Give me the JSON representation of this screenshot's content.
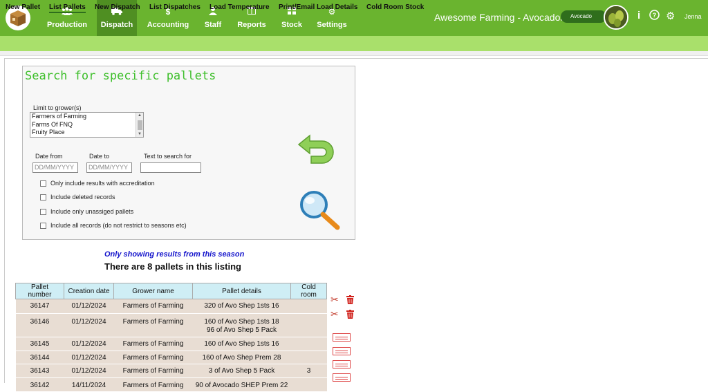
{
  "app": {
    "title": "Awesome Farming - Avocados",
    "crop_pill": "Avocado",
    "user": "Jenna"
  },
  "nav": [
    {
      "label": "Production",
      "icon": "users-icon"
    },
    {
      "label": "Dispatch",
      "icon": "truck-icon"
    },
    {
      "label": "Accounting",
      "icon": "dollar-icon"
    },
    {
      "label": "Staff",
      "icon": "person-icon"
    },
    {
      "label": "Reports",
      "icon": "columns-icon"
    },
    {
      "label": "Stock",
      "icon": "grid-icon"
    },
    {
      "label": "Settings",
      "icon": "gear-icon"
    }
  ],
  "subnav": [
    "New Pallet",
    "List Pallets",
    "New Dispatch",
    "List Dispatches",
    "Load Temperature",
    "Print/Email Load Details",
    "Cold Room Stock"
  ],
  "search": {
    "title": "Search for specific pallets",
    "grower_label": "Limit to grower(s)",
    "growers": [
      "Farmers of Farming",
      "Farms Of FNQ",
      "Fruity Place"
    ],
    "date_from_label": "Date from",
    "date_to_label": "Date to",
    "text_label": "Text to search for",
    "date_placeholder": "DD/MM/YYYY",
    "checkboxes": [
      "Only include results with accreditation",
      "Include deleted records",
      "Include only unassiged pallets",
      "Include all records (do not restrict to seasons etc)"
    ]
  },
  "results": {
    "season_note": "Only showing results from this season",
    "count_text": "There are 8 pallets in this listing",
    "headers": [
      "Pallet number",
      "Creation date",
      "Grower name",
      "Pallet details",
      "Cold room"
    ],
    "rows": [
      {
        "pallet": "36147",
        "date": "01/12/2024",
        "grower": "Farmers of Farming",
        "details": [
          "320 of Avo Shep 1sts 16"
        ],
        "cold": ""
      },
      {
        "pallet": "36146",
        "date": "01/12/2024",
        "grower": "Farmers of Farming",
        "details": [
          "160 of Avo Shep 1sts 18",
          "96 of Avo Shep 5 Pack"
        ],
        "cold": ""
      },
      {
        "pallet": "36145",
        "date": "01/12/2024",
        "grower": "Farmers of Farming",
        "details": [
          "160 of Avo Shep 1sts 16"
        ],
        "cold": ""
      },
      {
        "pallet": "36144",
        "date": "01/12/2024",
        "grower": "Farmers of Farming",
        "details": [
          "160 of Avo Shep Prem 28"
        ],
        "cold": ""
      },
      {
        "pallet": "36143",
        "date": "01/12/2024",
        "grower": "Farmers of Farming",
        "details": [
          "3 of Avo Shep 5 Pack"
        ],
        "cold": "3"
      },
      {
        "pallet": "36142",
        "date": "14/11/2024",
        "grower": "Farmers of Farming",
        "details": [
          "90 of Avocado SHEP Prem 22"
        ],
        "cold": ""
      }
    ]
  }
}
